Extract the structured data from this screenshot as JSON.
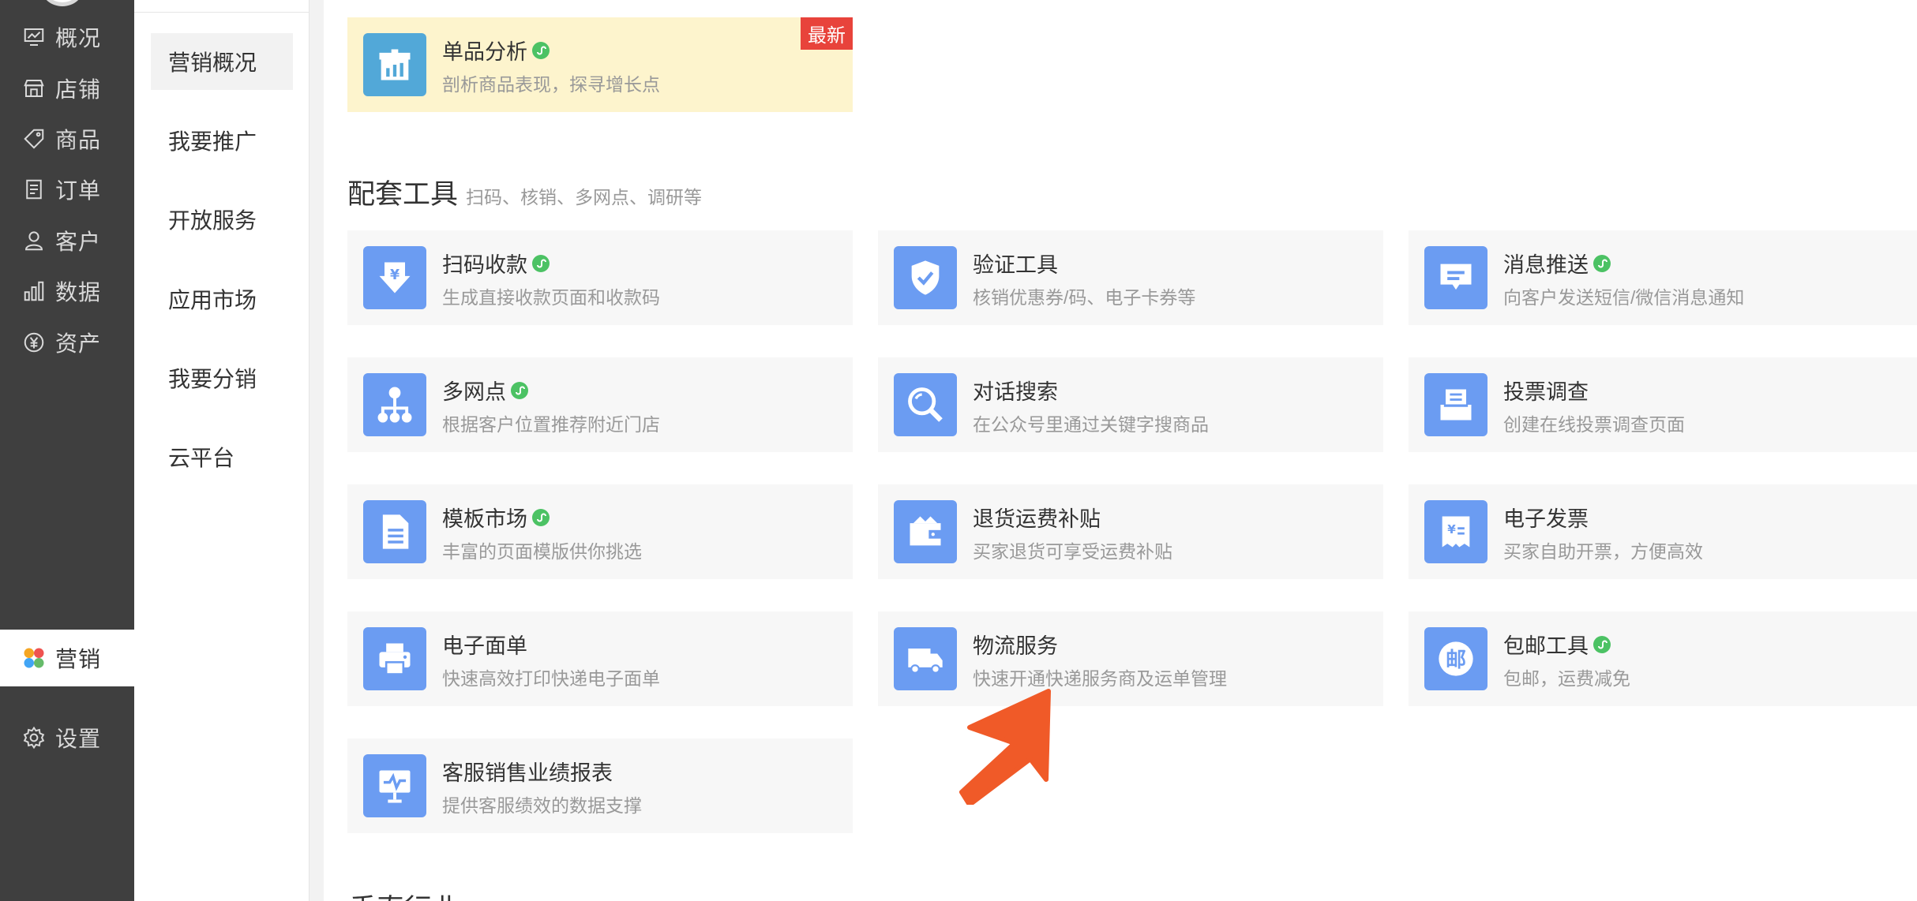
{
  "nav": {
    "items": [
      {
        "label": "概况",
        "icon": "overview-icon"
      },
      {
        "label": "店铺",
        "icon": "store-icon"
      },
      {
        "label": "商品",
        "icon": "tag-icon"
      },
      {
        "label": "订单",
        "icon": "order-icon"
      },
      {
        "label": "客户",
        "icon": "user-icon"
      },
      {
        "label": "数据",
        "icon": "bar-chart-icon"
      },
      {
        "label": "资产",
        "icon": "yuan-icon"
      },
      {
        "label": "营销",
        "icon": "marketing-icon",
        "active": true
      },
      {
        "label": "设置",
        "icon": "gear-icon"
      }
    ]
  },
  "subnav": {
    "items": [
      "营销概况",
      "我要推广",
      "开放服务",
      "应用市场",
      "我要分销",
      "云平台"
    ],
    "active": "营销概况"
  },
  "featured": {
    "title": "单品分析",
    "desc": "剖析商品表现，探寻增长点",
    "badge": "最新",
    "icon": "product-analysis-icon",
    "mini_program": true
  },
  "section": {
    "title": "配套工具",
    "subtitle": "扫码、核销、多网点、调研等"
  },
  "tools": [
    {
      "title": "扫码收款",
      "desc": "生成直接收款页面和收款码",
      "icon": "scan-pay-icon",
      "mini": true
    },
    {
      "title": "验证工具",
      "desc": "核销优惠券/码、电子卡券等",
      "icon": "shield-check-icon",
      "mini": false
    },
    {
      "title": "消息推送",
      "desc": "向客户发送短信/微信消息通知",
      "icon": "message-icon",
      "mini": true
    },
    {
      "title": "多网点",
      "desc": "根据客户位置推荐附近门店",
      "icon": "network-icon",
      "mini": true
    },
    {
      "title": "对话搜索",
      "desc": "在公众号里通过关键字搜商品",
      "icon": "magnifier-icon",
      "mini": false
    },
    {
      "title": "投票调查",
      "desc": "创建在线投票调查页面",
      "icon": "ballot-box-icon",
      "mini": false
    },
    {
      "title": "模板市场",
      "desc": "丰富的页面模版供你挑选",
      "icon": "document-icon",
      "mini": true
    },
    {
      "title": "退货运费补贴",
      "desc": "买家退货可享受运费补贴",
      "icon": "wallet-icon",
      "mini": false
    },
    {
      "title": "电子发票",
      "desc": "买家自助开票，方便高效",
      "icon": "invoice-icon",
      "mini": false
    },
    {
      "title": "电子面单",
      "desc": "快速高效打印快递电子面单",
      "icon": "printer-icon",
      "mini": false
    },
    {
      "title": "物流服务",
      "desc": "快速开通快递服务商及运单管理",
      "icon": "truck-icon",
      "mini": false
    },
    {
      "title": "包邮工具",
      "desc": "包邮，运费减免",
      "icon": "postage-icon",
      "icon_text": "邮",
      "mini": true
    },
    {
      "title": "客服销售业绩报表",
      "desc": "提供客服绩效的数据支撑",
      "icon": "monitor-chart-icon",
      "mini": false
    }
  ],
  "next_section": {
    "title": "垂直行业"
  },
  "colors": {
    "nav_bg": "#3f3f3f",
    "tool_icon_bg": "#6b9cf2",
    "featured_bg": "#fdf4cd",
    "badge_bg": "#e8433b",
    "mini_green": "#4cc264",
    "arrow": "#f05a28"
  }
}
